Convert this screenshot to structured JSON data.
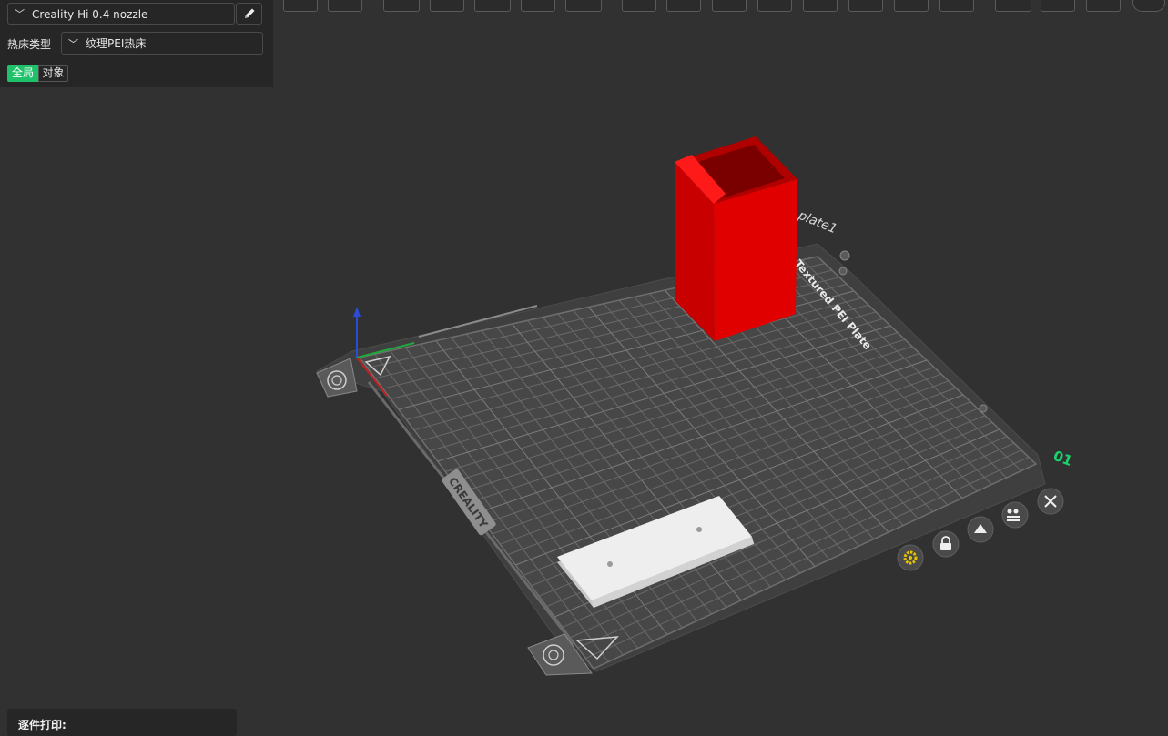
{
  "sidebar": {
    "printer": {
      "name": "Creality Hi 0.4 nozzle",
      "edit_icon": "pencil-icon"
    },
    "bed_type": {
      "label": "热床类型",
      "value": "纹理PEI热床"
    },
    "tabs": [
      {
        "label": "全局",
        "active": true
      },
      {
        "label": "对象",
        "active": false
      }
    ]
  },
  "toolbar": {
    "buttons": [
      "cube-view-icon",
      "keyboard-icon",
      "import-icon",
      "shape-icon",
      "auto-orient-icon",
      "arrange-icon",
      "layout-icon",
      "split-icon",
      "settings-icon",
      "measure-icon",
      "cut-icon",
      "support-icon",
      "paint-icon",
      "seam-icon",
      "text-icon",
      "variable-height-icon",
      "edit-icon",
      "flatten-icon",
      "more-icon"
    ]
  },
  "plate": {
    "name": "plate1",
    "bed_name": "Textured PEI Plate",
    "number": "01",
    "brand": "CREALITY",
    "actions": [
      "close-icon",
      "arrange-plate-icon",
      "orient-plate-icon",
      "lock-plate-icon",
      "plate-settings-icon"
    ]
  },
  "bottom": {
    "label": "逐件打印:"
  },
  "colors": {
    "accent": "#1fc26a",
    "model": "#d40000",
    "plate_number": "#19d46b"
  }
}
